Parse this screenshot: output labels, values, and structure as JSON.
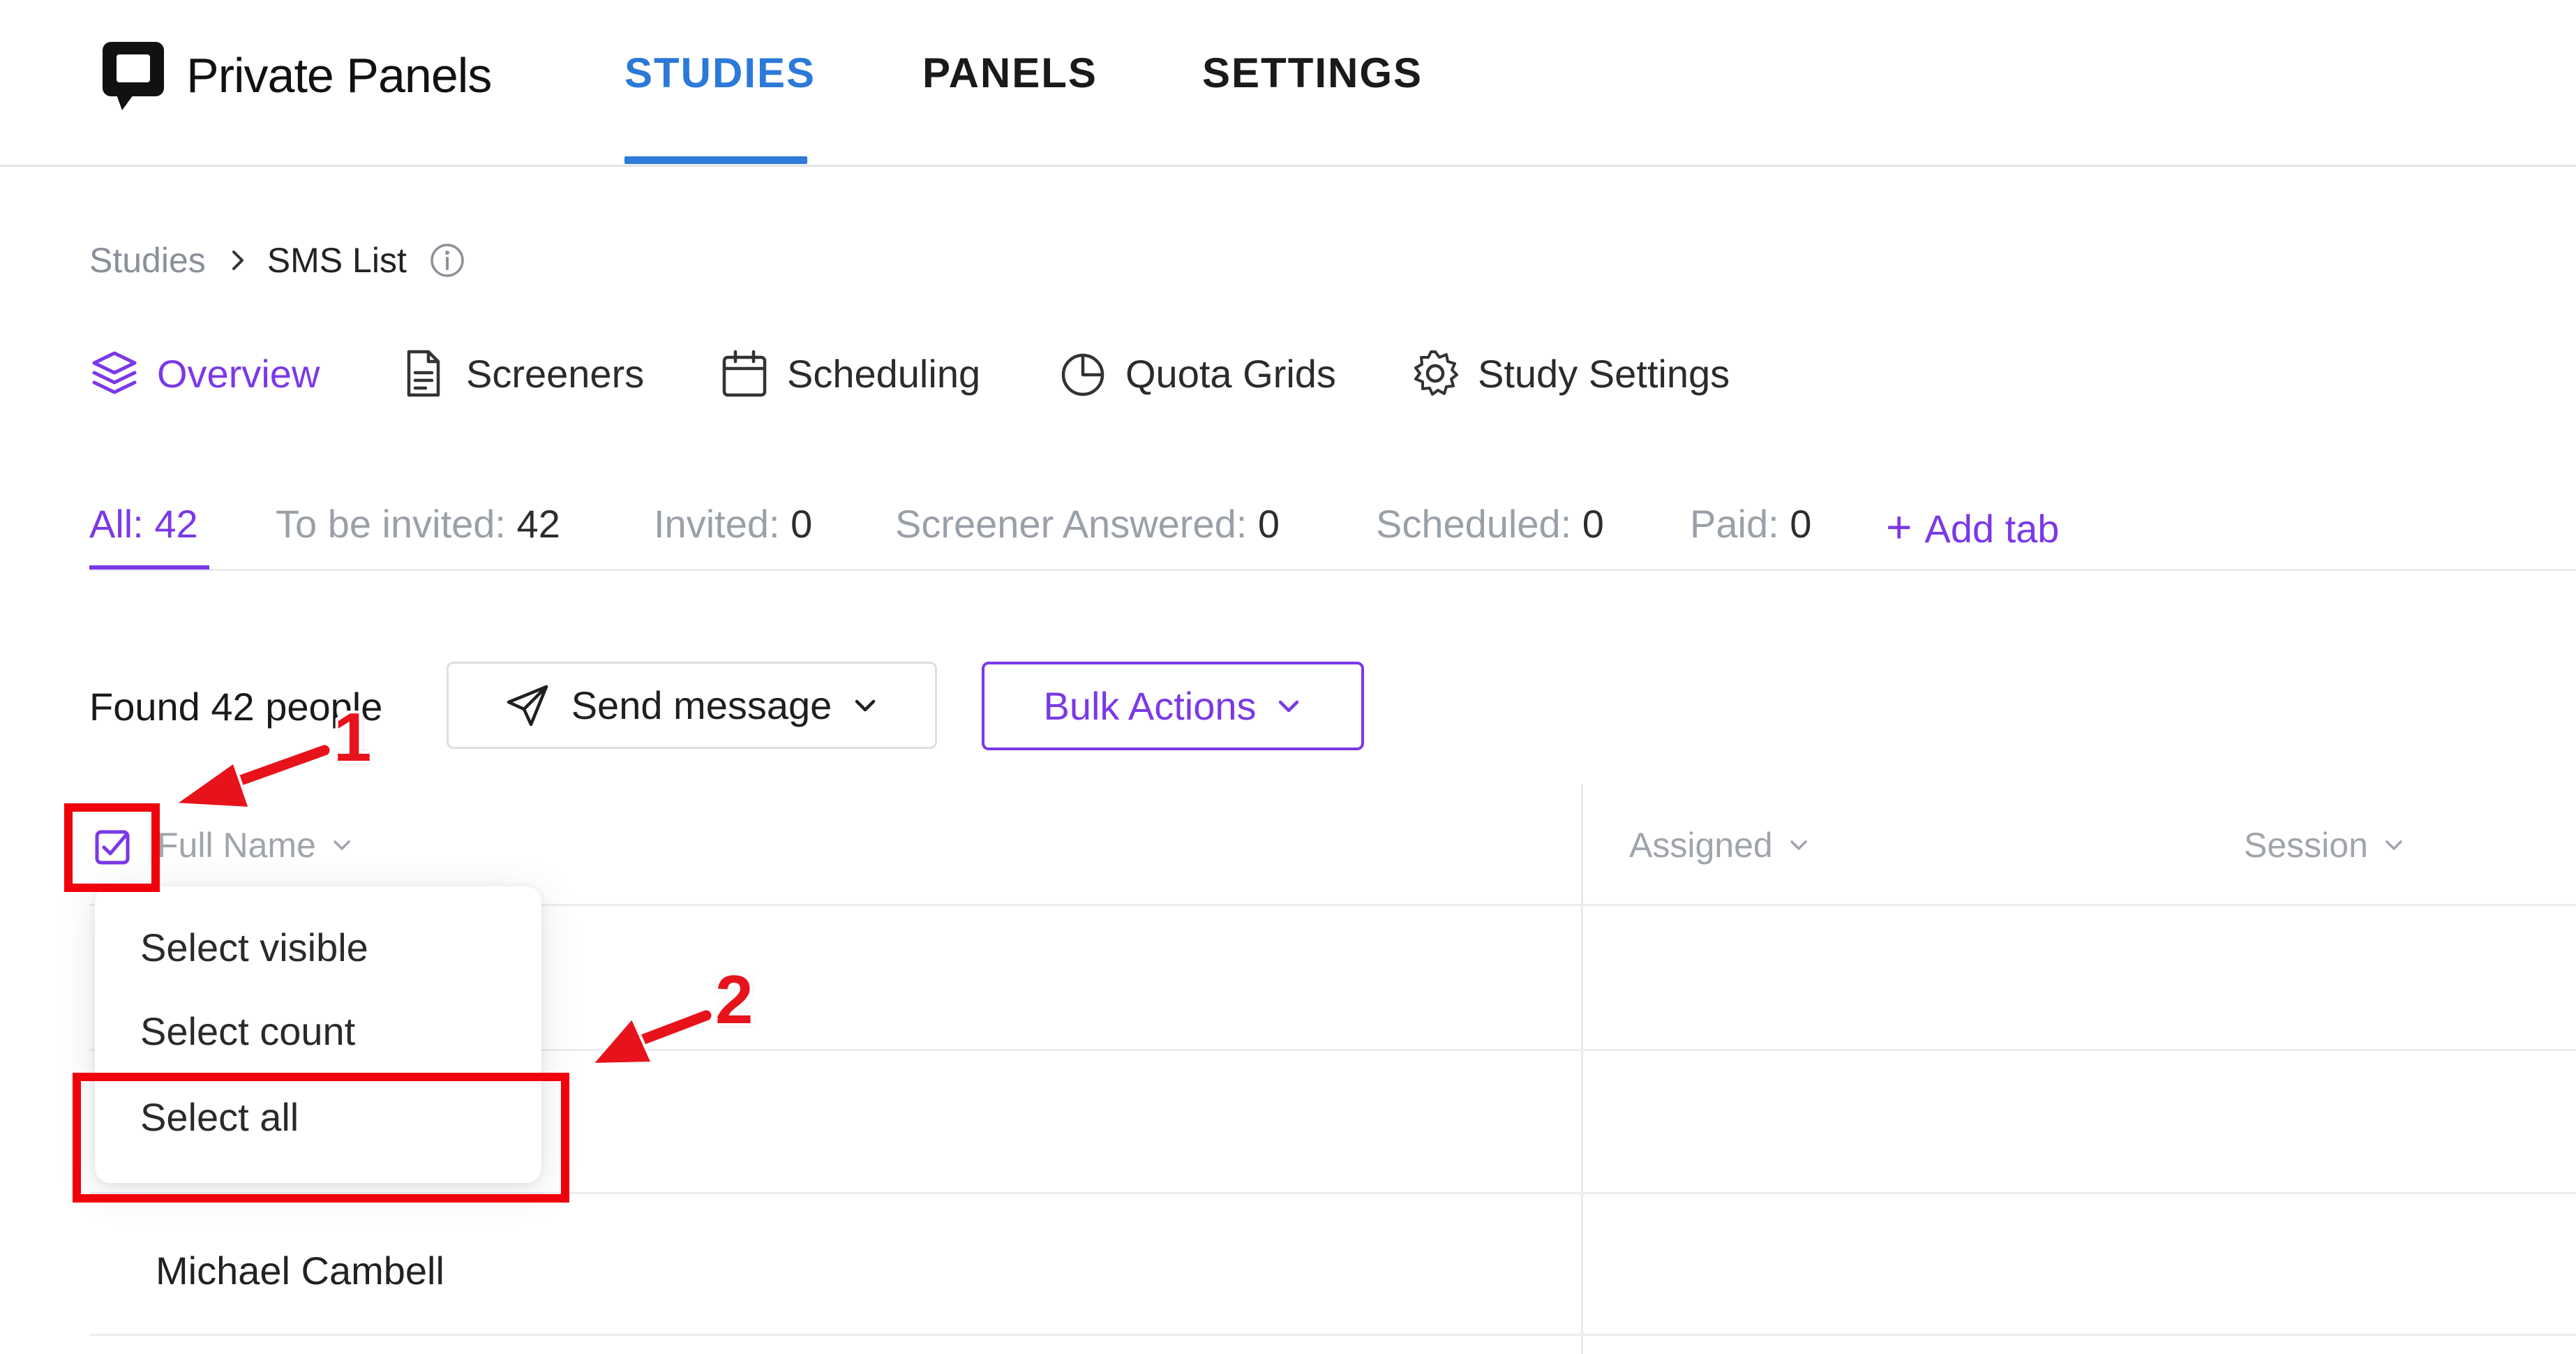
{
  "app": {
    "title": "Private Panels"
  },
  "nav": {
    "studies": "STUDIES",
    "panels": "PANELS",
    "settings": "SETTINGS"
  },
  "breadcrumb": {
    "parent": "Studies",
    "current": "SMS List"
  },
  "subnav": {
    "overview": "Overview",
    "screeners": "Screeners",
    "scheduling": "Scheduling",
    "quota": "Quota Grids",
    "settings": "Study Settings"
  },
  "status_tabs": [
    {
      "label": "All: ",
      "count": "42"
    },
    {
      "label": "To be invited: ",
      "count": "42"
    },
    {
      "label": "Invited: ",
      "count": "0"
    },
    {
      "label": "Screener Answered: ",
      "count": "0"
    },
    {
      "label": "Scheduled: ",
      "count": "0"
    },
    {
      "label": "Paid: ",
      "count": "0"
    }
  ],
  "add_tab": {
    "label": "Add tab"
  },
  "toolbar": {
    "found": "Found 42 people",
    "send_message": "Send message",
    "bulk_actions": "Bulk Actions"
  },
  "table": {
    "columns": [
      "Full Name",
      "Assigned",
      "Session"
    ],
    "rows": [
      {
        "name": "Michael Cambell"
      }
    ]
  },
  "select_menu": {
    "items": [
      "Select visible",
      "Select count",
      "Select all"
    ]
  },
  "annotations": {
    "step1": "1",
    "step2": "2"
  },
  "colors": {
    "accent": "#7b38e8",
    "nav_active": "#2b79d8",
    "annotation": "#f0000a"
  }
}
